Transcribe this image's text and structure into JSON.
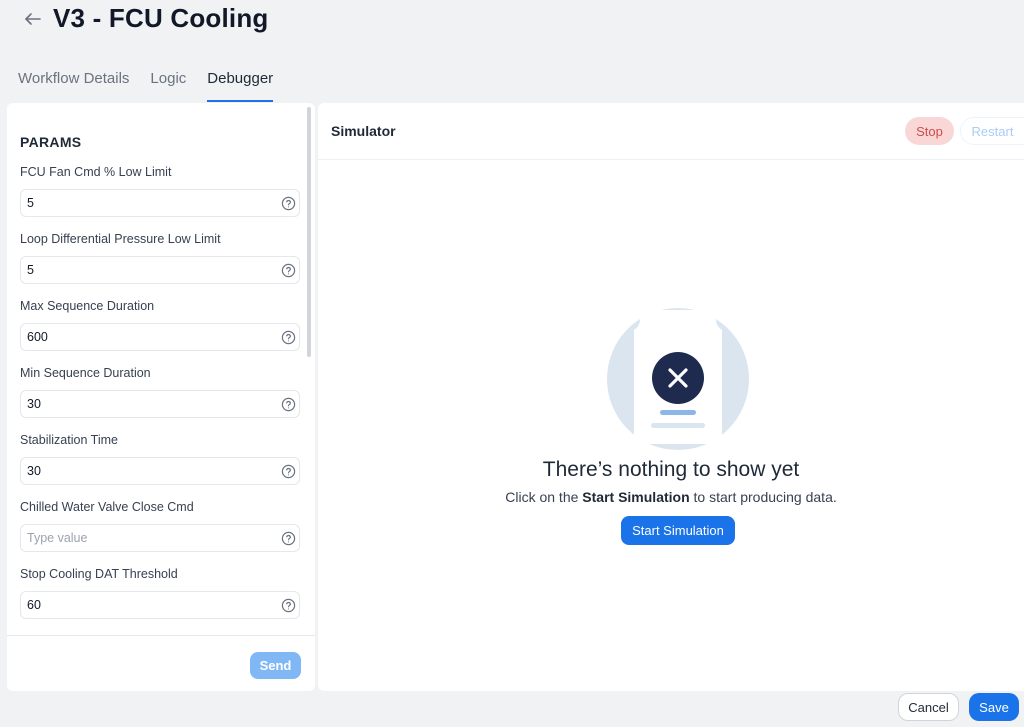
{
  "header": {
    "back_icon": "arrow-left-icon",
    "title": "V3 - FCU Cooling"
  },
  "tabs": [
    {
      "label": "Workflow Details",
      "active": false
    },
    {
      "label": "Logic",
      "active": false
    },
    {
      "label": "Debugger",
      "active": true
    }
  ],
  "params": {
    "title": "PARAMS",
    "help_icon": "question-circle-icon",
    "fields": [
      {
        "label": "FCU Fan Cmd % Low Limit",
        "value": "5",
        "placeholder": "Type value"
      },
      {
        "label": "Loop Differential Pressure Low Limit",
        "value": "5",
        "placeholder": "Type value"
      },
      {
        "label": "Max Sequence Duration",
        "value": "600",
        "placeholder": "Type value"
      },
      {
        "label": "Min Sequence Duration",
        "value": "30",
        "placeholder": "Type value"
      },
      {
        "label": "Stabilization Time",
        "value": "30",
        "placeholder": "Type value"
      },
      {
        "label": "Chilled Water Valve Close Cmd",
        "value": "",
        "placeholder": "Type value"
      },
      {
        "label": "Stop Cooling DAT Threshold",
        "value": "60",
        "placeholder": "Type value"
      }
    ],
    "send_label": "Send"
  },
  "simulator": {
    "title": "Simulator",
    "stop_label": "Stop",
    "restart_label": "Restart",
    "empty_icon": "document-error-icon",
    "empty_title": "There’s nothing to show yet",
    "empty_prefix": "Click on the ",
    "empty_bold": "Start Simulation",
    "empty_suffix": " to start producing data.",
    "start_label": "Start Simulation"
  },
  "footer": {
    "cancel_label": "Cancel",
    "save_label": "Save"
  },
  "colors": {
    "accent": "#1a73e8",
    "stop_bg": "#f9d7d7",
    "stop_text": "#d24b4b",
    "illustration_circle": "#dbe5f0",
    "illustration_badge": "#1e2b4f"
  }
}
